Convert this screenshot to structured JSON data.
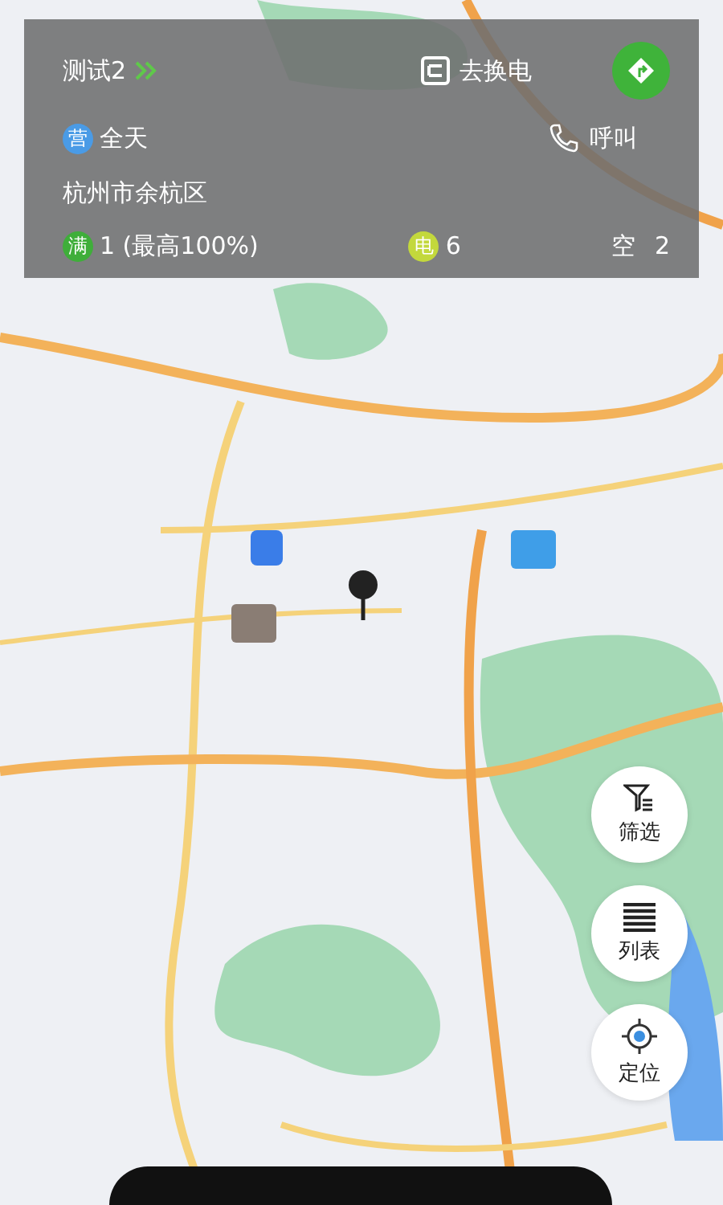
{
  "station_card": {
    "name": "测试2",
    "action": "去换电",
    "hours_badge": "营",
    "hours": "全天",
    "call": "呼叫",
    "address": "杭州市余杭区",
    "stats": [
      {
        "badge": "满",
        "value": "1 (最高100%)",
        "color": "#3fae3a"
      },
      {
        "badge": "电",
        "value": "6",
        "color": "#c3d83c"
      },
      {
        "badge": "空",
        "value": "2"
      }
    ]
  },
  "side_buttons": [
    {
      "kind": "filter",
      "label": "筛选"
    },
    {
      "kind": "list",
      "label": "列表"
    },
    {
      "kind": "locate",
      "label": "定位"
    }
  ]
}
